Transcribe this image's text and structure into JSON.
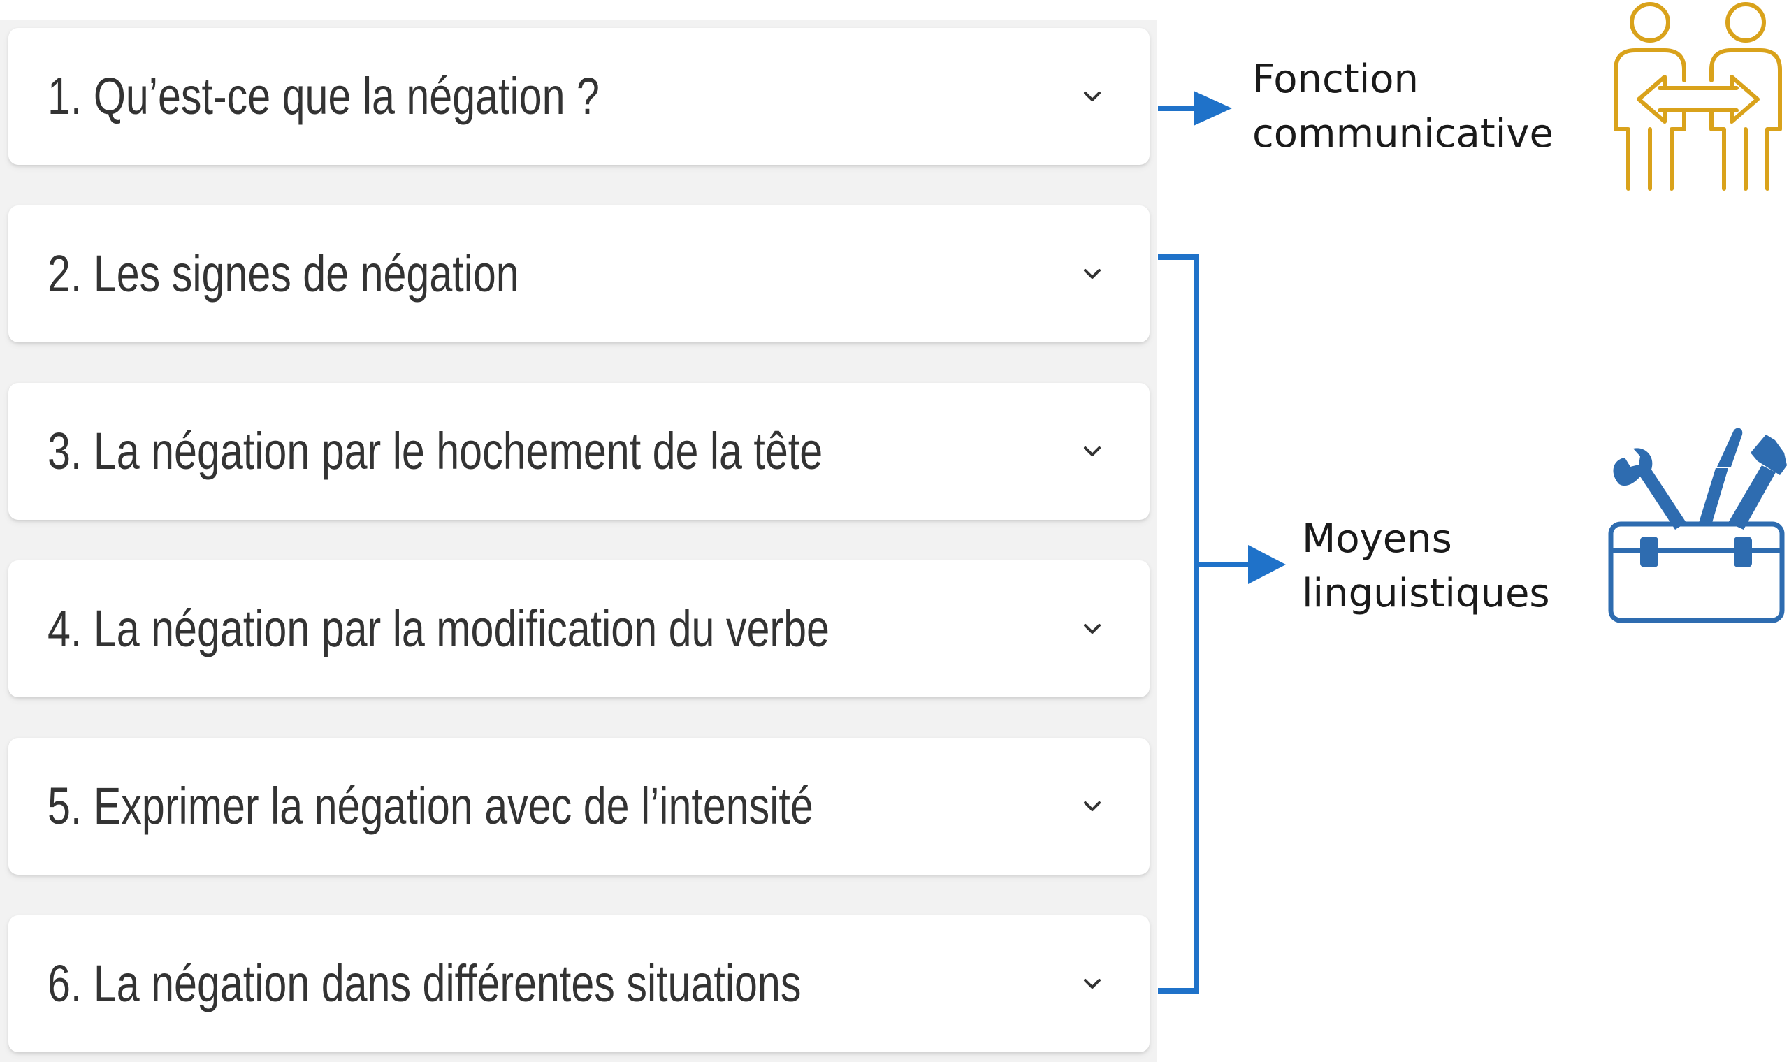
{
  "accordion": {
    "items": [
      {
        "label": "1. Qu’est-ce que la négation ?"
      },
      {
        "label": "2. Les signes de négation"
      },
      {
        "label": "3. La négation par le hochement de la tête"
      },
      {
        "label": "4. La négation par la modification du verbe"
      },
      {
        "label": "5. Exprimer la négation avec de l’intensité"
      },
      {
        "label": "6. La négation dans différentes situations"
      }
    ],
    "chevron_icon": "chevron-down-icon"
  },
  "annotations": {
    "communicative": {
      "line1": "Fonction",
      "line2": "communicative",
      "icon": "two-people-exchange-icon"
    },
    "linguistic": {
      "line1": "Moyens",
      "line2": "linguistiques",
      "icon": "toolbox-icon"
    }
  },
  "colors": {
    "connector_blue": "#1f72c9",
    "people_icon_gold": "#d9a21b",
    "toolbox_blue": "#2e6cb0",
    "panel_bg": "#f2f2f2",
    "text_dark": "#333333"
  }
}
